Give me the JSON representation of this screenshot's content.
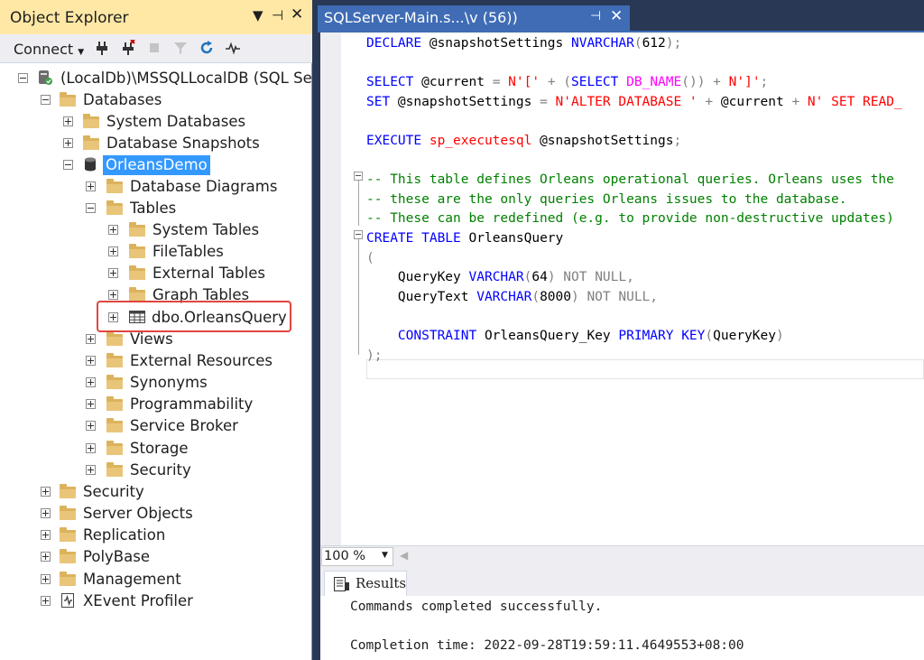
{
  "object_explorer": {
    "title": "Object Explorer",
    "pin_glyph": "▾ ⇃ ✕",
    "toolbar": {
      "connect_label": "Connect"
    },
    "tree": [
      {
        "id": "server",
        "label": "(LocalDb)\\MSSQLLocalDB (SQL Serv",
        "icon": "server-icon",
        "expanded": true
      },
      {
        "id": "databases",
        "label": "Databases",
        "icon": "folder-icon",
        "expanded": true
      },
      {
        "id": "system-databases",
        "label": "System Databases",
        "icon": "folder-icon",
        "expanded": false
      },
      {
        "id": "database-snapshots",
        "label": "Database Snapshots",
        "icon": "folder-icon",
        "expanded": false
      },
      {
        "id": "orleansdemo",
        "label": "OrleansDemo",
        "icon": "database-icon",
        "expanded": true,
        "selected": true
      },
      {
        "id": "database-diagrams",
        "label": "Database Diagrams",
        "icon": "folder-icon",
        "expanded": false
      },
      {
        "id": "tables",
        "label": "Tables",
        "icon": "folder-icon",
        "expanded": true
      },
      {
        "id": "system-tables",
        "label": "System Tables",
        "icon": "folder-icon",
        "expanded": false
      },
      {
        "id": "filetables",
        "label": "FileTables",
        "icon": "folder-icon",
        "expanded": false
      },
      {
        "id": "external-tables",
        "label": "External Tables",
        "icon": "folder-icon",
        "expanded": false
      },
      {
        "id": "graph-tables",
        "label": "Graph Tables",
        "icon": "folder-icon",
        "expanded": false
      },
      {
        "id": "dbo-orleansquery",
        "label": "dbo.OrleansQuery",
        "icon": "table-icon",
        "expanded": false,
        "highlighted": true
      },
      {
        "id": "views",
        "label": "Views",
        "icon": "folder-icon",
        "expanded": false
      },
      {
        "id": "external-resources",
        "label": "External Resources",
        "icon": "folder-icon",
        "expanded": false
      },
      {
        "id": "synonyms",
        "label": "Synonyms",
        "icon": "folder-icon",
        "expanded": false
      },
      {
        "id": "programmability",
        "label": "Programmability",
        "icon": "folder-icon",
        "expanded": false
      },
      {
        "id": "service-broker",
        "label": "Service Broker",
        "icon": "folder-icon",
        "expanded": false
      },
      {
        "id": "storage",
        "label": "Storage",
        "icon": "folder-icon",
        "expanded": false
      },
      {
        "id": "db-security",
        "label": "Security",
        "icon": "folder-icon",
        "expanded": false
      },
      {
        "id": "security",
        "label": "Security",
        "icon": "folder-icon",
        "expanded": false
      },
      {
        "id": "server-objects",
        "label": "Server Objects",
        "icon": "folder-icon",
        "expanded": false
      },
      {
        "id": "replication",
        "label": "Replication",
        "icon": "folder-icon",
        "expanded": false
      },
      {
        "id": "polybase",
        "label": "PolyBase",
        "icon": "folder-icon",
        "expanded": false
      },
      {
        "id": "management",
        "label": "Management",
        "icon": "folder-icon",
        "expanded": false
      },
      {
        "id": "xevent-profiler",
        "label": "XEvent Profiler",
        "icon": "xevent-icon",
        "expanded": false
      }
    ]
  },
  "editor": {
    "tab_title": "SQLServer-Main.s...\\v          (56))",
    "code_lines": [
      [
        [
          "kw",
          "DECLARE "
        ],
        [
          "id",
          "@snapshotSettings "
        ],
        [
          "kw",
          "NVARCHAR"
        ],
        [
          "gr",
          "("
        ],
        [
          "id",
          "612"
        ],
        [
          "gr",
          ");"
        ]
      ],
      [],
      [
        [
          "kw",
          "SELECT "
        ],
        [
          "id",
          "@current "
        ],
        [
          "gr",
          "= "
        ],
        [
          "str",
          "N'[' "
        ],
        [
          "gr",
          "+ ("
        ],
        [
          "kw",
          "SELECT "
        ],
        [
          "fn",
          "DB_NAME"
        ],
        [
          "gr",
          "()) + "
        ],
        [
          "str",
          "N']'"
        ],
        [
          "gr",
          ";"
        ]
      ],
      [
        [
          "kw",
          "SET "
        ],
        [
          "id",
          "@snapshotSettings "
        ],
        [
          "gr",
          "= "
        ],
        [
          "str",
          "N'ALTER DATABASE ' "
        ],
        [
          "gr",
          "+ "
        ],
        [
          "id",
          "@current "
        ],
        [
          "gr",
          "+ "
        ],
        [
          "str",
          "N' SET READ_"
        ]
      ],
      [],
      [
        [
          "kw",
          "EXECUTE "
        ],
        [
          "str",
          "sp_executesql "
        ],
        [
          "id",
          "@snapshotSettings"
        ],
        [
          "gr",
          ";"
        ]
      ],
      [],
      [
        [
          "cm",
          "-- This table defines Orleans operational queries. Orleans uses the"
        ]
      ],
      [
        [
          "cm",
          "-- these are the only queries Orleans issues to the database."
        ]
      ],
      [
        [
          "cm",
          "-- These can be redefined (e.g. to provide non-destructive updates)"
        ]
      ],
      [
        [
          "kw",
          "CREATE TABLE "
        ],
        [
          "id",
          "OrleansQuery"
        ]
      ],
      [
        [
          "gr",
          "("
        ]
      ],
      [
        [
          "id",
          "    QueryKey "
        ],
        [
          "kw",
          "VARCHAR"
        ],
        [
          "gr",
          "("
        ],
        [
          "id",
          "64"
        ],
        [
          "gr",
          ") NOT NULL,"
        ]
      ],
      [
        [
          "id",
          "    QueryText "
        ],
        [
          "kw",
          "VARCHAR"
        ],
        [
          "gr",
          "("
        ],
        [
          "id",
          "8000"
        ],
        [
          "gr",
          ") NOT NULL,"
        ]
      ],
      [],
      [
        [
          "id",
          "    "
        ],
        [
          "kw",
          "CONSTRAINT "
        ],
        [
          "id",
          "OrleansQuery_Key "
        ],
        [
          "kw",
          "PRIMARY KEY"
        ],
        [
          "gr",
          "("
        ],
        [
          "id",
          "QueryKey"
        ],
        [
          "gr",
          ")"
        ]
      ],
      [
        [
          "gr",
          ");"
        ]
      ]
    ]
  },
  "zoom": {
    "value": "100 %"
  },
  "results": {
    "tab_label": "Results",
    "line1": "Commands completed successfully.",
    "line2": "Completion time: 2022-09-28T19:59:11.4649553+08:00"
  },
  "colors": {
    "title_bar": "#ffe8a6",
    "tab_active": "#3f6cb5",
    "selection": "#3399ff",
    "highlight_box": "#e0453f",
    "folder": "#dcb35c"
  }
}
